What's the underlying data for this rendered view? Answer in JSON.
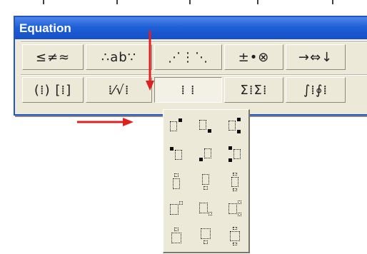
{
  "window": {
    "title": "Equation"
  },
  "toolbar": {
    "row1": [
      {
        "label": "≤≠≈",
        "name": "relational-symbols-button"
      },
      {
        "label": "∴ab∵",
        "name": "spaces-ellipses-button"
      },
      {
        "label": "⋰⋮⋱",
        "name": "embellishments-button"
      },
      {
        "label": "±•⊗",
        "name": "operator-symbols-button"
      },
      {
        "label": "→⇔↓",
        "name": "arrow-symbols-button"
      }
    ],
    "row2": [
      {
        "label": "(⁞) [⁞]",
        "name": "fence-templates-button"
      },
      {
        "label": "⁞⁄√⁞",
        "name": "fraction-radical-templates-button"
      },
      {
        "label": "⁞ ⁞",
        "name": "subscript-superscript-templates-button"
      },
      {
        "label": "Σ⁞Σ⁞",
        "name": "summation-templates-button"
      },
      {
        "label": "∫⁞∮⁞",
        "name": "integral-templates-button"
      }
    ]
  },
  "palette": {
    "items": [
      "superscript-right",
      "subscript-right",
      "sub-superscript-right",
      "superscript-left",
      "subscript-left",
      "sub-superscript-left",
      "over-script",
      "under-script",
      "over-under-script",
      "superscript-small",
      "subscript-small",
      "sub-superscript-small",
      "over-script-small",
      "under-script-small",
      "over-under-script-small"
    ]
  },
  "colors": {
    "arrow": "#e02020",
    "title_bar": "#1f5fd6",
    "window_bg": "#ece9d8"
  }
}
